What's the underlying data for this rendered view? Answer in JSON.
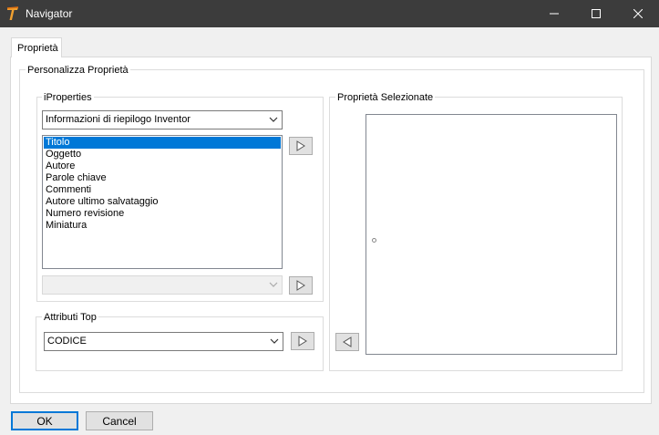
{
  "window": {
    "title": "Navigator",
    "icon": "inventor-t-icon",
    "controls": [
      "minimize-icon",
      "maximize-icon",
      "close-icon"
    ]
  },
  "tabs": [
    {
      "label": "Proprietà",
      "active": true
    }
  ],
  "customize_group": {
    "label": "Personalizza Proprietà"
  },
  "iproperties": {
    "label": "iProperties",
    "category_select": {
      "value": "Informazioni di riepilogo Inventor"
    },
    "properties_list": {
      "items": [
        "Titolo",
        "Oggetto",
        "Autore",
        "Parole chiave",
        "Commenti",
        "Autore ultimo salvataggio",
        "Numero revisione",
        "Miniatura"
      ],
      "selected_index": 0
    },
    "custom_select": {
      "value": "",
      "disabled": true
    }
  },
  "top_attributes": {
    "label": "Attributi Top",
    "select": {
      "value": "CODICE"
    }
  },
  "selected_properties": {
    "label": "Proprietà Selezionate",
    "items": []
  },
  "buttons": {
    "ok": "OK",
    "cancel": "Cancel"
  },
  "colors": {
    "titlebar": "#3c3c3c",
    "selection": "#0078d7",
    "default_button_border": "#0078d7"
  }
}
